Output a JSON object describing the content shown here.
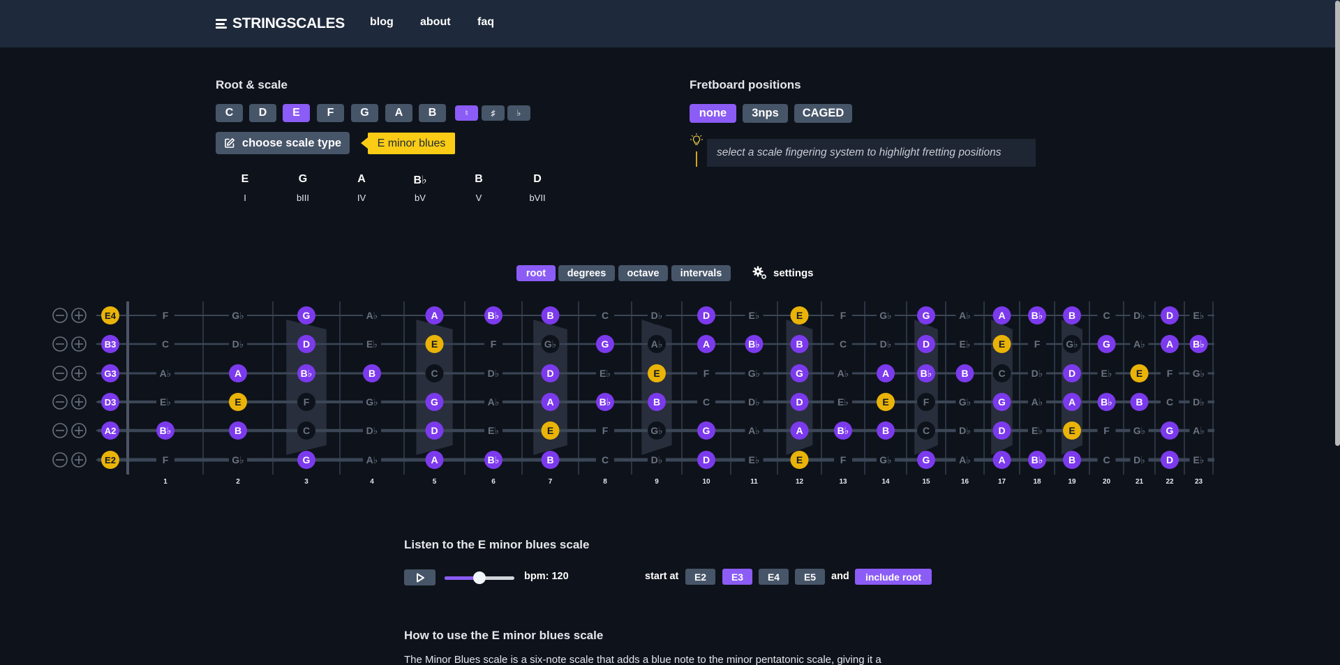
{
  "header": {
    "brand": "STRINGSCALES",
    "nav": [
      {
        "label": "blog"
      },
      {
        "label": "about"
      },
      {
        "label": "faq"
      }
    ]
  },
  "root_scale": {
    "title": "Root & scale",
    "roots": [
      {
        "label": "C",
        "active": false
      },
      {
        "label": "D",
        "active": false
      },
      {
        "label": "E",
        "active": true
      },
      {
        "label": "F",
        "active": false
      },
      {
        "label": "G",
        "active": false
      },
      {
        "label": "A",
        "active": false
      },
      {
        "label": "B",
        "active": false
      }
    ],
    "accidentals": [
      {
        "label": "♮",
        "name": "natural",
        "active": true
      },
      {
        "label": "♯",
        "name": "sharp",
        "active": false
      },
      {
        "label": "♭",
        "name": "flat",
        "active": false
      }
    ],
    "choose_label": "choose scale type",
    "selected_scale": "E minor blues",
    "degrees": [
      {
        "note": "E",
        "roman": "I"
      },
      {
        "note": "G",
        "roman": "bIII"
      },
      {
        "note": "A",
        "roman": "IV"
      },
      {
        "note": "B♭",
        "roman": "bV"
      },
      {
        "note": "B",
        "roman": "V"
      },
      {
        "note": "D",
        "roman": "bVII"
      }
    ]
  },
  "positions": {
    "title": "Fretboard positions",
    "options": [
      {
        "label": "none",
        "active": true
      },
      {
        "label": "3nps",
        "active": false
      },
      {
        "label": "CAGED",
        "active": false
      }
    ],
    "hint": "select a scale fingering system to highlight fretting positions"
  },
  "display_modes": {
    "options": [
      {
        "label": "root",
        "active": true
      },
      {
        "label": "degrees",
        "active": false
      },
      {
        "label": "octave",
        "active": false
      },
      {
        "label": "intervals",
        "active": false
      }
    ],
    "settings_label": "settings"
  },
  "fretboard": {
    "fret_count": 23,
    "fret_numbers": [
      "1",
      "2",
      "3",
      "4",
      "5",
      "6",
      "7",
      "8",
      "9",
      "10",
      "11",
      "12",
      "13",
      "14",
      "15",
      "16",
      "17",
      "18",
      "19",
      "20",
      "21",
      "22",
      "23"
    ],
    "inlay_frets": [
      3,
      5,
      7,
      9,
      12,
      15,
      17,
      19
    ],
    "colors": {
      "root": "#eab308",
      "scale": "#7c3aed",
      "inactive_text": "#6b7280",
      "inlay_dark_note": "#0e131b"
    },
    "strings": [
      {
        "open": "E4",
        "open_type": "root",
        "notes": [
          "F",
          "G♭",
          "G",
          "A♭",
          "A",
          "B♭",
          "B",
          "C",
          "D♭",
          "D",
          "E♭",
          "E",
          "F",
          "G♭",
          "G",
          "A♭",
          "A",
          "B♭",
          "B",
          "C",
          "D♭",
          "D",
          "E♭"
        ]
      },
      {
        "open": "B3",
        "open_type": "scale",
        "notes": [
          "C",
          "D♭",
          "D",
          "E♭",
          "E",
          "F",
          "G♭",
          "G",
          "A♭",
          "A",
          "B♭",
          "B",
          "C",
          "D♭",
          "D",
          "E♭",
          "E",
          "F",
          "G♭",
          "G",
          "A♭",
          "A",
          "B♭"
        ]
      },
      {
        "open": "G3",
        "open_type": "scale",
        "notes": [
          "A♭",
          "A",
          "B♭",
          "B",
          "C",
          "D♭",
          "D",
          "E♭",
          "E",
          "F",
          "G♭",
          "G",
          "A♭",
          "A",
          "B♭",
          "B",
          "C",
          "D♭",
          "D",
          "E♭",
          "E",
          "F",
          "G♭"
        ]
      },
      {
        "open": "D3",
        "open_type": "scale",
        "notes": [
          "E♭",
          "E",
          "F",
          "G♭",
          "G",
          "A♭",
          "A",
          "B♭",
          "B",
          "C",
          "D♭",
          "D",
          "E♭",
          "E",
          "F",
          "G♭",
          "G",
          "A♭",
          "A",
          "B♭",
          "B",
          "C",
          "D♭"
        ]
      },
      {
        "open": "A2",
        "open_type": "scale",
        "notes": [
          "B♭",
          "B",
          "C",
          "D♭",
          "D",
          "E♭",
          "E",
          "F",
          "G♭",
          "G",
          "A♭",
          "A",
          "B♭",
          "B",
          "C",
          "D♭",
          "D",
          "E♭",
          "E",
          "F",
          "G♭",
          "G",
          "A♭"
        ]
      },
      {
        "open": "E2",
        "open_type": "root",
        "notes": [
          "F",
          "G♭",
          "G",
          "A♭",
          "A",
          "B♭",
          "B",
          "C",
          "D♭",
          "D",
          "E♭",
          "E",
          "F",
          "G♭",
          "G",
          "A♭",
          "A",
          "B♭",
          "B",
          "C",
          "D♭",
          "D",
          "E♭"
        ]
      }
    ],
    "scale_notes": [
      "E",
      "G",
      "A",
      "B♭",
      "B",
      "D"
    ],
    "root_note": "E"
  },
  "listen": {
    "title": "Listen to the E minor blues scale",
    "bpm_label": "bpm: 120",
    "tempo_fraction": 0.5,
    "start_at_label": "start at",
    "start_options": [
      {
        "label": "E2",
        "active": false
      },
      {
        "label": "E3",
        "active": true
      },
      {
        "label": "E4",
        "active": false
      },
      {
        "label": "E5",
        "active": false
      }
    ],
    "and_label": "and",
    "include_root_label": "include root",
    "include_root_active": true
  },
  "howto": {
    "title": "How to use the E minor blues scale",
    "text": "The Minor Blues scale is a six-note scale that adds a blue note to the minor pentatonic scale, giving it a"
  }
}
